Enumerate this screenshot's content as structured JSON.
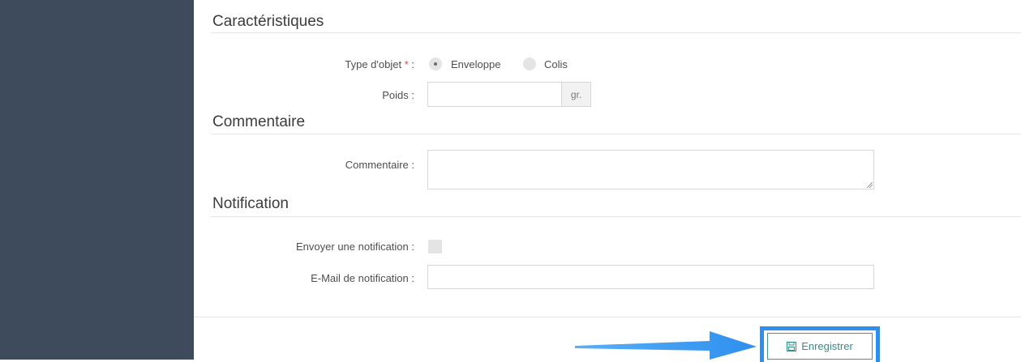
{
  "sections": {
    "caracteristiques": {
      "title": "Caractéristiques",
      "type_label": "Type d'objet",
      "required_mark": "*",
      "colon": ":",
      "radio_options": [
        "Enveloppe",
        "Colis"
      ],
      "selected_option": "Enveloppe",
      "poids_label": "Poids :",
      "poids_value": "",
      "poids_unit": "gr."
    },
    "commentaire": {
      "title": "Commentaire",
      "label": "Commentaire :",
      "value": ""
    },
    "notification": {
      "title": "Notification",
      "send_label": "Envoyer une notification :",
      "send_checked": false,
      "email_label": "E-Mail de notification :",
      "email_value": ""
    }
  },
  "footer": {
    "save_label": "Enregistrer",
    "save_icon": "floppy-disk-icon",
    "highlight_color": "#2e90ee",
    "button_color": "#2f8f85"
  },
  "colors": {
    "sidebar": "#3e4b5c",
    "accent_required": "#d9534f"
  }
}
